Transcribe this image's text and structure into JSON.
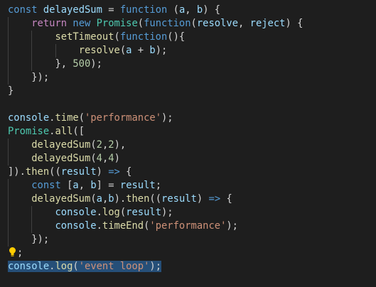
{
  "lines": [
    [
      {
        "t": "const",
        "c": "kw"
      },
      {
        "t": " ",
        "c": "punc"
      },
      {
        "t": "delayedSum",
        "c": "var"
      },
      {
        "t": " = ",
        "c": "punc"
      },
      {
        "t": "function",
        "c": "kw"
      },
      {
        "t": " (",
        "c": "punc"
      },
      {
        "t": "a",
        "c": "var"
      },
      {
        "t": ", ",
        "c": "punc"
      },
      {
        "t": "b",
        "c": "var"
      },
      {
        "t": ") {",
        "c": "punc"
      }
    ],
    [
      {
        "t": "    ",
        "c": "punc"
      },
      {
        "t": "return",
        "c": "ctl"
      },
      {
        "t": " ",
        "c": "punc"
      },
      {
        "t": "new",
        "c": "kw"
      },
      {
        "t": " ",
        "c": "punc"
      },
      {
        "t": "Promise",
        "c": "cls"
      },
      {
        "t": "(",
        "c": "punc"
      },
      {
        "t": "function",
        "c": "kw"
      },
      {
        "t": "(",
        "c": "punc"
      },
      {
        "t": "resolve",
        "c": "var"
      },
      {
        "t": ", ",
        "c": "punc"
      },
      {
        "t": "reject",
        "c": "var"
      },
      {
        "t": ") {",
        "c": "punc"
      }
    ],
    [
      {
        "t": "        ",
        "c": "punc"
      },
      {
        "t": "setTimeout",
        "c": "fn"
      },
      {
        "t": "(",
        "c": "punc"
      },
      {
        "t": "function",
        "c": "kw"
      },
      {
        "t": "(){",
        "c": "punc"
      }
    ],
    [
      {
        "t": "            ",
        "c": "punc"
      },
      {
        "t": "resolve",
        "c": "fn"
      },
      {
        "t": "(",
        "c": "punc"
      },
      {
        "t": "a",
        "c": "var"
      },
      {
        "t": " + ",
        "c": "punc"
      },
      {
        "t": "b",
        "c": "var"
      },
      {
        "t": ");",
        "c": "punc"
      }
    ],
    [
      {
        "t": "        }, ",
        "c": "punc"
      },
      {
        "t": "500",
        "c": "num"
      },
      {
        "t": ");",
        "c": "punc"
      }
    ],
    [
      {
        "t": "    });",
        "c": "punc"
      }
    ],
    [
      {
        "t": "}",
        "c": "punc"
      }
    ],
    [],
    [
      {
        "t": "console",
        "c": "var"
      },
      {
        "t": ".",
        "c": "punc"
      },
      {
        "t": "time",
        "c": "fn"
      },
      {
        "t": "(",
        "c": "punc"
      },
      {
        "t": "'performance'",
        "c": "str"
      },
      {
        "t": ");",
        "c": "punc"
      }
    ],
    [
      {
        "t": "Promise",
        "c": "cls"
      },
      {
        "t": ".",
        "c": "punc"
      },
      {
        "t": "all",
        "c": "fn"
      },
      {
        "t": "([",
        "c": "punc"
      }
    ],
    [
      {
        "t": "    ",
        "c": "punc"
      },
      {
        "t": "delayedSum",
        "c": "fn"
      },
      {
        "t": "(",
        "c": "punc"
      },
      {
        "t": "2",
        "c": "num"
      },
      {
        "t": ",",
        "c": "punc"
      },
      {
        "t": "2",
        "c": "num"
      },
      {
        "t": "),",
        "c": "punc"
      }
    ],
    [
      {
        "t": "    ",
        "c": "punc"
      },
      {
        "t": "delayedSum",
        "c": "fn"
      },
      {
        "t": "(",
        "c": "punc"
      },
      {
        "t": "4",
        "c": "num"
      },
      {
        "t": ",",
        "c": "punc"
      },
      {
        "t": "4",
        "c": "num"
      },
      {
        "t": ")",
        "c": "punc"
      }
    ],
    [
      {
        "t": "]).",
        "c": "punc"
      },
      {
        "t": "then",
        "c": "fn"
      },
      {
        "t": "((",
        "c": "punc"
      },
      {
        "t": "result",
        "c": "var"
      },
      {
        "t": ") ",
        "c": "punc"
      },
      {
        "t": "=>",
        "c": "kw"
      },
      {
        "t": " {",
        "c": "punc"
      }
    ],
    [
      {
        "t": "    ",
        "c": "punc"
      },
      {
        "t": "const",
        "c": "kw"
      },
      {
        "t": " [",
        "c": "punc"
      },
      {
        "t": "a",
        "c": "var"
      },
      {
        "t": ", ",
        "c": "punc"
      },
      {
        "t": "b",
        "c": "var"
      },
      {
        "t": "] = ",
        "c": "punc"
      },
      {
        "t": "result",
        "c": "var"
      },
      {
        "t": ";",
        "c": "punc"
      }
    ],
    [
      {
        "t": "    ",
        "c": "punc"
      },
      {
        "t": "delayedSum",
        "c": "fn"
      },
      {
        "t": "(",
        "c": "punc"
      },
      {
        "t": "a",
        "c": "var"
      },
      {
        "t": ",",
        "c": "punc"
      },
      {
        "t": "b",
        "c": "var"
      },
      {
        "t": ").",
        "c": "punc"
      },
      {
        "t": "then",
        "c": "fn"
      },
      {
        "t": "((",
        "c": "punc"
      },
      {
        "t": "result",
        "c": "var"
      },
      {
        "t": ") ",
        "c": "punc"
      },
      {
        "t": "=>",
        "c": "kw"
      },
      {
        "t": " {",
        "c": "punc"
      }
    ],
    [
      {
        "t": "        ",
        "c": "punc"
      },
      {
        "t": "console",
        "c": "var"
      },
      {
        "t": ".",
        "c": "punc"
      },
      {
        "t": "log",
        "c": "fn"
      },
      {
        "t": "(",
        "c": "punc"
      },
      {
        "t": "result",
        "c": "var"
      },
      {
        "t": ");",
        "c": "punc"
      }
    ],
    [
      {
        "t": "        ",
        "c": "punc"
      },
      {
        "t": "console",
        "c": "var"
      },
      {
        "t": ".",
        "c": "punc"
      },
      {
        "t": "timeEnd",
        "c": "fn"
      },
      {
        "t": "(",
        "c": "punc"
      },
      {
        "t": "'performance'",
        "c": "str"
      },
      {
        "t": ");",
        "c": "punc"
      }
    ],
    [
      {
        "t": "    });",
        "c": "punc"
      }
    ],
    [
      {
        "t": "});",
        "c": "punc",
        "bulb": true
      }
    ],
    [
      {
        "t": "console",
        "c": "var"
      },
      {
        "t": ".",
        "c": "punc"
      },
      {
        "t": "log",
        "c": "fn"
      },
      {
        "t": "(",
        "c": "punc"
      },
      {
        "t": "'event loop'",
        "c": "str"
      },
      {
        "t": ");",
        "c": "punc"
      }
    ]
  ],
  "highlighted_line": 19,
  "icons": {
    "lightbulb": "lightbulb-icon"
  },
  "colors": {
    "background": "#1e1e1e",
    "keyword": "#569cd6",
    "control": "#c586c0",
    "variable": "#9cdcfe",
    "function": "#dcdcaa",
    "class": "#4ec9b0",
    "string": "#ce9178",
    "number": "#b5cea8",
    "selection": "#264f78",
    "lightbulb": "#ffcc00"
  }
}
